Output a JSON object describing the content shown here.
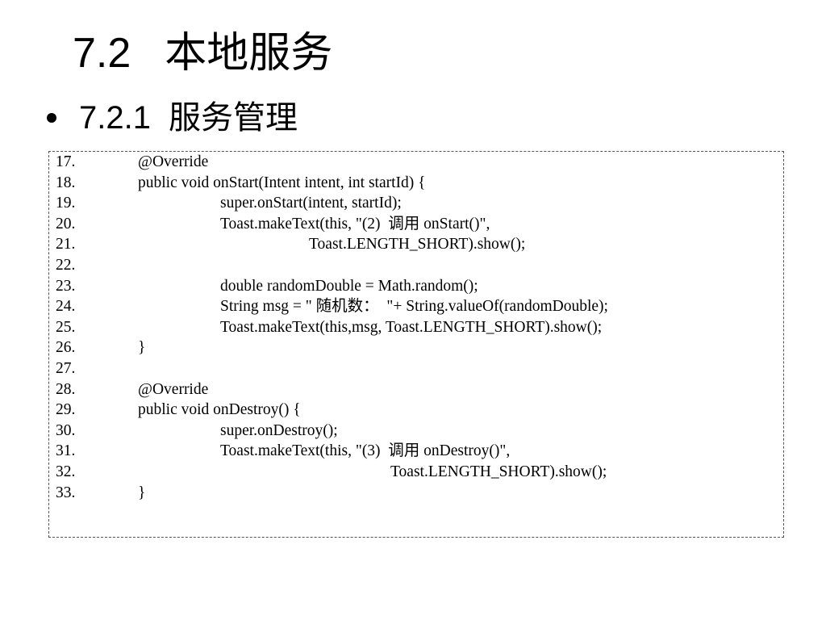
{
  "slide": {
    "title_number": "7.2",
    "title_text": "本地服务",
    "subheading_number": "7.2.1",
    "subheading_text": "服务管理"
  },
  "code_lines": [
    {
      "num": "17.",
      "text": "@Override",
      "indent": 1
    },
    {
      "num": "18.",
      "text": "public void onStart(Intent intent, int startId) {",
      "indent": 1
    },
    {
      "num": "19.",
      "text": "super.onStart(intent, startId);",
      "indent": 2
    },
    {
      "num": "20.",
      "text": "Toast.makeText(this, \"(2)  调用 onStart()\",",
      "indent": 2
    },
    {
      "num": "21.",
      "text": "Toast.LENGTH_SHORT).show();",
      "indent": 3
    },
    {
      "num": "22.",
      "text": "",
      "indent": 0
    },
    {
      "num": "23.",
      "text": "double randomDouble = Math.random();",
      "indent": 2
    },
    {
      "num": "24.",
      "text": "String msg = \" 随机数：  \"+ String.valueOf(randomDouble);",
      "indent": 2
    },
    {
      "num": "25.",
      "text": "Toast.makeText(this,msg, Toast.LENGTH_SHORT).show();",
      "indent": 2
    },
    {
      "num": "26.",
      "text": "}",
      "indent": 1
    },
    {
      "num": "27.",
      "text": "",
      "indent": 0
    },
    {
      "num": "28.",
      "text": "@Override",
      "indent": 1
    },
    {
      "num": "29.",
      "text": "public void onDestroy() {",
      "indent": 1
    },
    {
      "num": "30.",
      "text": "super.onDestroy();",
      "indent": 2
    },
    {
      "num": "31.",
      "text": "Toast.makeText(this, \"(3)  调用 onDestroy()\",",
      "indent": 2
    },
    {
      "num": "32.",
      "text": "Toast.LENGTH_SHORT).show();",
      "indent": 4
    },
    {
      "num": "33.",
      "text": "}",
      "indent": 1
    }
  ]
}
